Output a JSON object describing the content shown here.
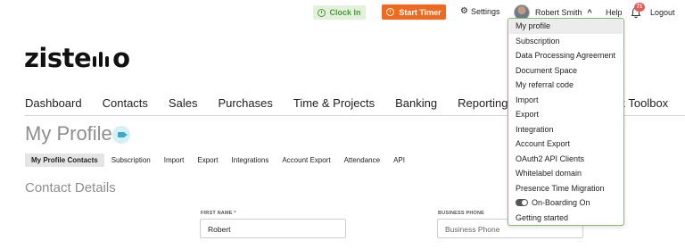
{
  "topbar": {
    "clock_in": "Clock In",
    "start_timer": "Start Timer",
    "settings": "Settings",
    "user_name": "Robert Smith",
    "help": "Help",
    "notifications_count": "71",
    "logout": "Logout"
  },
  "logo": {
    "text_left": "zist",
    "text_mid": "e",
    "text_right": "o"
  },
  "nav": {
    "items": [
      "Dashboard",
      "Contacts",
      "Sales",
      "Purchases",
      "Time & Projects",
      "Banking",
      "Reporting"
    ],
    "right_item": "ck Toolbox"
  },
  "page": {
    "title": "My Profile"
  },
  "subnav": {
    "items": [
      "My Profile Contacts",
      "Subscription",
      "Import",
      "Export",
      "Integrations",
      "Account Export",
      "Attendance",
      "API"
    ]
  },
  "section": {
    "title": "Contact Details"
  },
  "form": {
    "first_name_label": "FIRST NAME *",
    "first_name_value": "Robert",
    "business_phone_label": "BUSINESS PHONE",
    "business_phone_placeholder": "Business Phone"
  },
  "dropdown": {
    "items": [
      "My profile",
      "Subscription",
      "Data Processing Agreement",
      "Document Space",
      "My referral code",
      "Import",
      "Export",
      "Integration",
      "Account Export",
      "OAuth2 API Clients",
      "Whitelabel domain",
      "Presence Time Migration",
      "On-Boarding On",
      "Getting started"
    ]
  },
  "colors": {
    "clock_green": "#4c9a3f",
    "timer_orange": "#ef6a1f",
    "dropdown_border": "#7fbf6a",
    "badge_red": "#e65a5a"
  }
}
